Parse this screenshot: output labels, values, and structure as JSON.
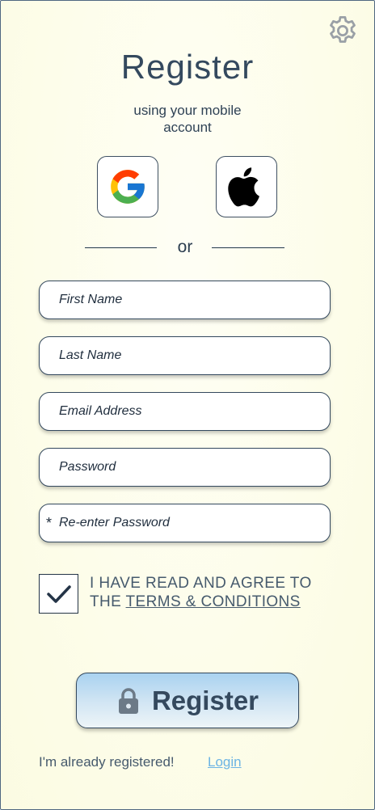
{
  "header": {
    "title": "Register",
    "subtitle_line1": "using your mobile",
    "subtitle_line2": "account"
  },
  "divider": {
    "text": "or"
  },
  "form": {
    "first_name_placeholder": "First Name",
    "last_name_placeholder": "Last Name",
    "email_placeholder": "Email Address",
    "password_placeholder": "Password",
    "reenter_required_mark": "*",
    "reenter_placeholder": "Re-enter Password"
  },
  "agreement": {
    "checked": true,
    "line1": "I HAVE READ AND AGREE TO",
    "line2_prefix": "THE ",
    "terms_link": "TERMS & CONDITIONS"
  },
  "register_button": {
    "label": "Register"
  },
  "footer": {
    "already_text": "I'm already registered!",
    "login_link": "Login"
  },
  "icons": {
    "settings": "gear-icon",
    "google": "google-icon",
    "apple": "apple-icon",
    "lock": "lock-icon",
    "check": "check-icon"
  },
  "colors": {
    "background": "#fdfde9",
    "text_primary": "#34495e",
    "button_gradient_top": "#a9d2f0",
    "link": "#6cb4e4"
  }
}
